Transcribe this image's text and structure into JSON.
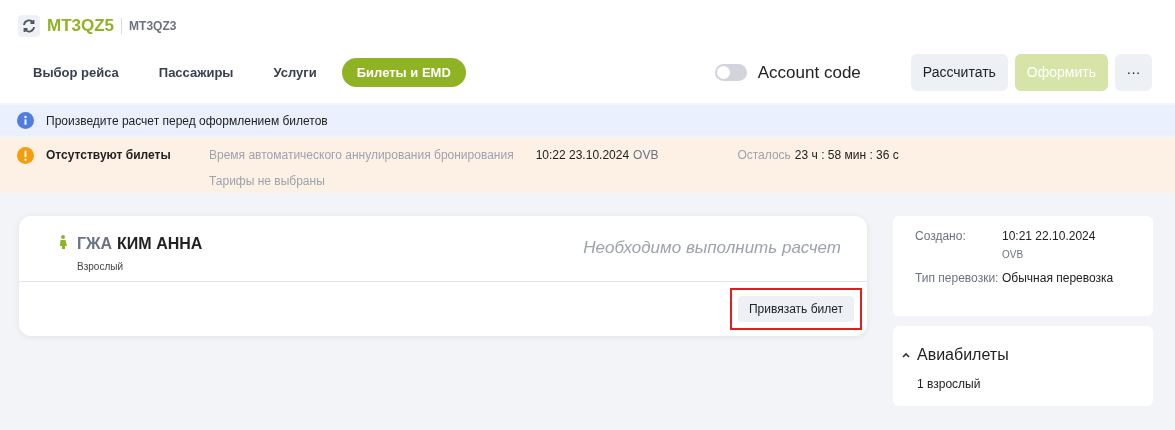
{
  "header": {
    "booking_code": "MT3QZ5",
    "secondary_code": "MT3QZ3"
  },
  "tabs": [
    {
      "label": "Выбор рейса",
      "selected": false
    },
    {
      "label": "Пассажиры",
      "selected": false
    },
    {
      "label": "Услуги",
      "selected": false
    },
    {
      "label": "Билеты и EMD",
      "selected": true
    }
  ],
  "account_code": {
    "label": "Account code",
    "on": false
  },
  "actions": [
    {
      "label": "Рассчитать",
      "disabled": false
    },
    {
      "label": "Оформить",
      "disabled": true
    },
    {
      "label": "···",
      "disabled": false
    }
  ],
  "info_banner": {
    "text": "Произведите расчет перед оформлением билетов"
  },
  "warning_banner": {
    "title": "Отсутствуют билеты",
    "cancel_label": "Время автоматического аннулирования бронирования",
    "cancel_time": "10:22 23.10.2024",
    "cancel_city": "OVB",
    "fares_note": "Тарифы не выбраны",
    "remaining_label": "Осталось",
    "remaining_value": "23 ч : 58 мин : 36 с"
  },
  "passenger": {
    "code": "ГЖА",
    "name": "КИМ АННА",
    "type": "Взрослый",
    "status": "Необходимо выполнить расчет",
    "button": {
      "label": "Привязать билет",
      "highlighted": true
    }
  },
  "details": [
    {
      "label": "Создано:",
      "value": "10:21 22.10.2024",
      "sub": "OVB"
    },
    {
      "label": "Тип перевозки:",
      "value": "Обычная перевозка"
    }
  ],
  "tickets_panel": {
    "title": "Авиабилеты",
    "expanded": true,
    "summary": "1 взрослый"
  }
}
